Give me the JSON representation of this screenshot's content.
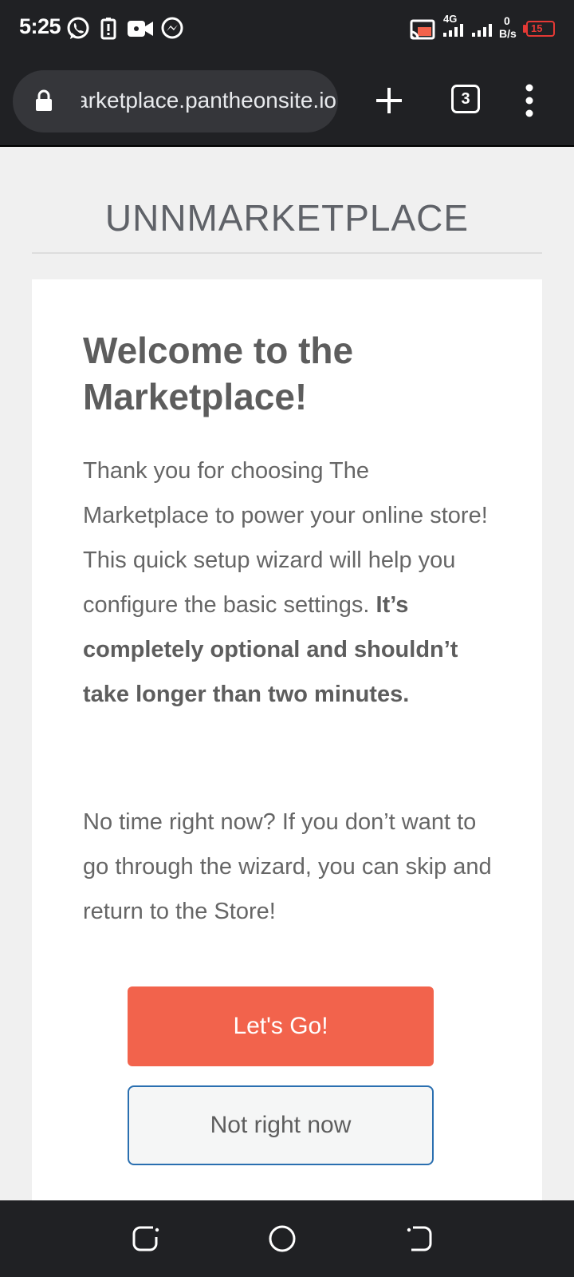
{
  "status_bar": {
    "time": "5:25",
    "network": "4G",
    "data_rate_value": "0",
    "data_rate_unit": "B/s",
    "battery": "15",
    "icons": [
      "whatsapp-icon",
      "alert-icon",
      "video-icon",
      "messenger-icon",
      "cast-icon",
      "signal-icon",
      "signal-icon",
      "battery-icon"
    ]
  },
  "browser": {
    "url": "unnmarketplace.pantheonsite.io",
    "tab_count": "3"
  },
  "page": {
    "site_title": "UNNMARKETPLACE",
    "heading": "Welcome to the Marketplace!",
    "intro": "Thank you for choosing The Marketplace to power your online store! This quick setup wizard will help you configure the basic settings. ",
    "intro_bold": "It’s completely optional and shouldn’t take longer than two minutes.",
    "skip_text": "No time right now? If you don’t want to go through the wizard, you can skip and return to the Store!",
    "primary_button": "Let's Go!",
    "secondary_button": "Not right now"
  },
  "colors": {
    "accent": "#f2634c",
    "secondary_border": "#2a6fb0",
    "chrome_dark": "#202124",
    "page_bg": "#f0f0f0",
    "battery_low": "#e53935"
  }
}
